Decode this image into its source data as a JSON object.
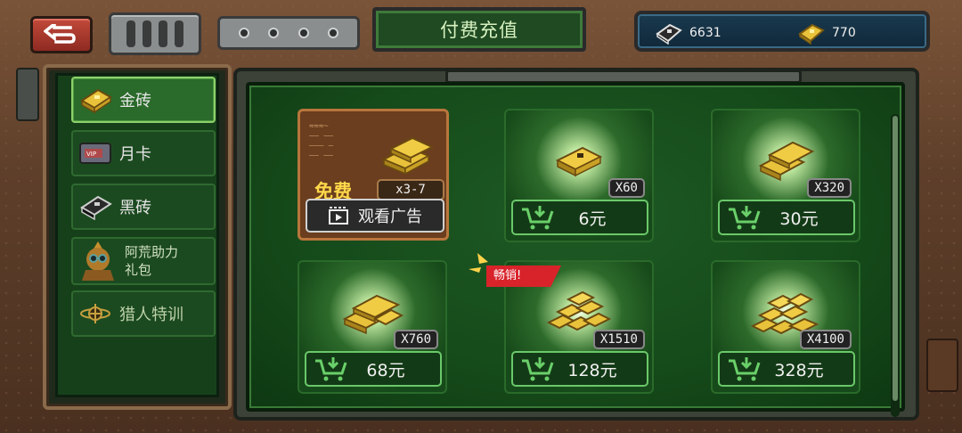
{
  "header": {
    "title": "付费充值",
    "currency": {
      "black_brick": {
        "icon": "black-brick-icon",
        "value": "6631"
      },
      "gold_brick": {
        "icon": "gold-brick-icon",
        "value": "770"
      }
    }
  },
  "menu": {
    "items": [
      {
        "label": "金砖",
        "icon": "gold-brick-icon",
        "active": true
      },
      {
        "label": "月卡",
        "icon": "vip-card-icon"
      },
      {
        "label": "黑砖",
        "icon": "black-brick-icon"
      },
      {
        "label": "阿荒助力\n礼包",
        "icon": "character-icon"
      },
      {
        "label": "猎人特训",
        "icon": "hunter-emblem-icon"
      }
    ]
  },
  "shop": {
    "free": {
      "label": "免费",
      "range": "x3-7",
      "ad_button": "观看广告"
    },
    "hot_tag": "畅销!",
    "packs": [
      {
        "count": "X60",
        "price": "6元"
      },
      {
        "count": "X320",
        "price": "30元"
      },
      {
        "count": "X760",
        "price": "68元"
      },
      {
        "count": "X1510",
        "price": "128元"
      },
      {
        "count": "X4100",
        "price": "328元"
      }
    ]
  },
  "colors": {
    "panel_green": "#1e5a24",
    "gold": "#e8c23a",
    "hot_red": "#d8232a",
    "back_red": "#c24a3a"
  }
}
